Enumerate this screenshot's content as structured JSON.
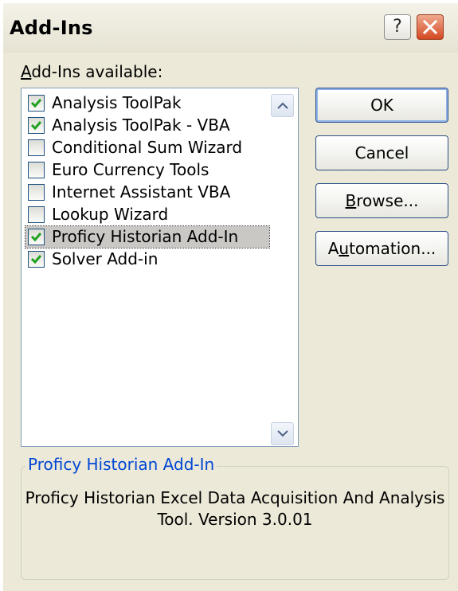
{
  "title": "Add-Ins",
  "title_buttons": {
    "help": "?"
  },
  "available_label_prefix": "A",
  "available_label_rest": "dd-Ins available:",
  "items": [
    {
      "label": "Analysis ToolPak",
      "checked": true
    },
    {
      "label": "Analysis ToolPak - VBA",
      "checked": true
    },
    {
      "label": "Conditional Sum Wizard",
      "checked": false
    },
    {
      "label": "Euro Currency Tools",
      "checked": false
    },
    {
      "label": "Internet Assistant VBA",
      "checked": false
    },
    {
      "label": "Lookup Wizard",
      "checked": false
    },
    {
      "label": "Proficy Historian Add-In",
      "checked": true,
      "selected": true
    },
    {
      "label": "Solver Add-in",
      "checked": true
    }
  ],
  "buttons": {
    "ok": "OK",
    "cancel": "Cancel",
    "browse_ul": "B",
    "browse_rest": "rowse...",
    "automation_pre": "A",
    "automation_ul": "u",
    "automation_rest": "tomation..."
  },
  "group": {
    "title": "Proficy Historian Add-In",
    "description_line1": "Proficy Historian Excel Data Acquisition And Analysis",
    "description_line2": "Tool. Version 3.0.01"
  },
  "colors": {
    "accent": "#0046d5",
    "check": "#21a121",
    "close": "#d44a22"
  }
}
